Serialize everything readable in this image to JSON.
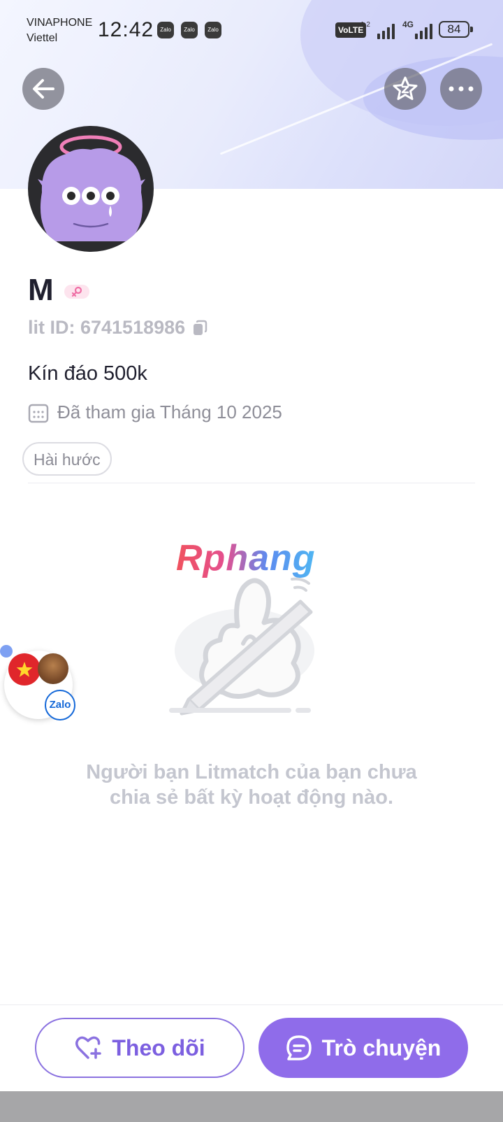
{
  "status_bar": {
    "carrier_primary": "VINAPHONE",
    "carrier_secondary": "Viettel",
    "time": "12:42",
    "notification_apps": [
      "Zalo",
      "Zalo",
      "Zalo"
    ],
    "volte_label": "VoLTE",
    "volte_sim": "1 2",
    "network_type": "4G",
    "battery_level": "84"
  },
  "header": {
    "back_icon": "arrow-left-icon",
    "favorite_icon": "star-icon",
    "more_icon": "more-dots-icon"
  },
  "profile": {
    "name": "M",
    "gender_icon": "female-symbol-icon",
    "lit_id": "lit ID: 6741518986",
    "bio": "Kín đáo 500k",
    "joined": "Đã tham gia Tháng 10 2025",
    "tags": [
      "Hài hước"
    ]
  },
  "feed": {
    "watermark": "Rphang",
    "empty_message_line1": "Người bạn Litmatch của bạn chưa",
    "empty_message_line2": "chia sẻ bất kỳ hoạt động nào."
  },
  "floating_bubble": {
    "badge_label": "Zalo"
  },
  "actions": {
    "follow_label": "Theo dõi",
    "chat_label": "Trò chuyện"
  },
  "colors": {
    "accent": "#8f6cea",
    "accent_text": "#7c5fe0",
    "muted_text": "#b9b9c2"
  }
}
